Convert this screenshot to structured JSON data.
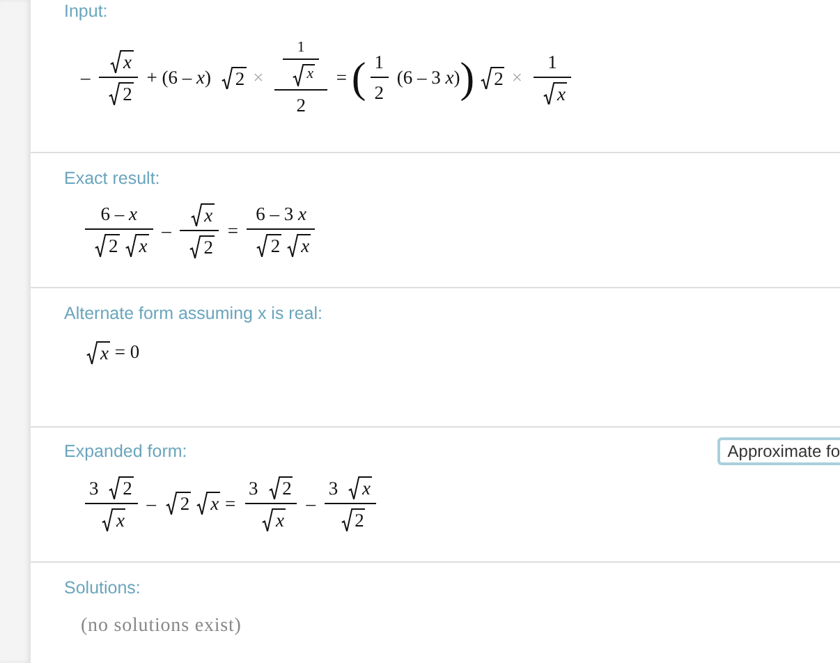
{
  "pods": [
    {
      "title": "Input:",
      "formula": [
        {
          "kind": "text",
          "text": "– "
        },
        {
          "kind": "frac",
          "num": [
            {
              "kind": "sqrt",
              "body": [
                {
                  "kind": "var",
                  "text": "x"
                }
              ]
            }
          ],
          "den": [
            {
              "kind": "sqrt",
              "body": [
                {
                  "kind": "text",
                  "text": "2"
                }
              ]
            }
          ]
        },
        {
          "kind": "text",
          "text": " + (6 – "
        },
        {
          "kind": "var",
          "text": "x"
        },
        {
          "kind": "text",
          "text": ") "
        },
        {
          "kind": "sqrt",
          "body": [
            {
              "kind": "text",
              "text": "2"
            }
          ]
        },
        {
          "kind": "times",
          "text": "×"
        },
        {
          "kind": "frac",
          "num": [
            {
              "kind": "frac",
              "num": [
                {
                  "kind": "text",
                  "text": "1"
                }
              ],
              "den": [
                {
                  "kind": "sqrt",
                  "body": [
                    {
                      "kind": "var",
                      "text": "x"
                    }
                  ]
                }
              ]
            }
          ],
          "den": [
            {
              "kind": "text",
              "text": "2"
            }
          ]
        },
        {
          "kind": "text",
          "text": " = "
        },
        {
          "kind": "paren",
          "open": "(",
          "close": ")",
          "body": [
            {
              "kind": "frac",
              "num": [
                {
                  "kind": "text",
                  "text": "1"
                }
              ],
              "den": [
                {
                  "kind": "text",
                  "text": "2"
                }
              ]
            },
            {
              "kind": "text",
              "text": " (6 – 3 "
            },
            {
              "kind": "var",
              "text": "x"
            },
            {
              "kind": "text",
              "text": ")"
            }
          ]
        },
        {
          "kind": "sqrt",
          "body": [
            {
              "kind": "text",
              "text": "2"
            }
          ]
        },
        {
          "kind": "times",
          "text": "×"
        },
        {
          "kind": "frac",
          "num": [
            {
              "kind": "text",
              "text": "1"
            }
          ],
          "den": [
            {
              "kind": "sqrt",
              "body": [
                {
                  "kind": "var",
                  "text": "x"
                }
              ]
            }
          ]
        }
      ]
    },
    {
      "title": "Exact result:",
      "formula": [
        {
          "kind": "frac",
          "num": [
            {
              "kind": "text",
              "text": "6 – "
            },
            {
              "kind": "var",
              "text": "x"
            }
          ],
          "den": [
            {
              "kind": "sqrt",
              "body": [
                {
                  "kind": "text",
                  "text": "2"
                }
              ]
            },
            {
              "kind": "sqrt",
              "body": [
                {
                  "kind": "var",
                  "text": "x"
                }
              ]
            }
          ]
        },
        {
          "kind": "text",
          "text": " – "
        },
        {
          "kind": "frac",
          "num": [
            {
              "kind": "sqrt",
              "body": [
                {
                  "kind": "var",
                  "text": "x"
                }
              ]
            }
          ],
          "den": [
            {
              "kind": "sqrt",
              "body": [
                {
                  "kind": "text",
                  "text": "2"
                }
              ]
            }
          ]
        },
        {
          "kind": "text",
          "text": " = "
        },
        {
          "kind": "frac",
          "num": [
            {
              "kind": "text",
              "text": "6 – 3 "
            },
            {
              "kind": "var",
              "text": "x"
            }
          ],
          "den": [
            {
              "kind": "sqrt",
              "body": [
                {
                  "kind": "text",
                  "text": "2"
                }
              ]
            },
            {
              "kind": "sqrt",
              "body": [
                {
                  "kind": "var",
                  "text": "x"
                }
              ]
            }
          ]
        }
      ]
    },
    {
      "title": "Alternate form assuming x is real:",
      "formula": [
        {
          "kind": "sqrt",
          "body": [
            {
              "kind": "var",
              "text": "x"
            }
          ]
        },
        {
          "kind": "text",
          "text": " = 0"
        }
      ]
    },
    {
      "title": "Expanded form:",
      "button": "Approximate fo",
      "formula": [
        {
          "kind": "frac",
          "num": [
            {
              "kind": "text",
              "text": "3 "
            },
            {
              "kind": "sqrt",
              "body": [
                {
                  "kind": "text",
                  "text": "2"
                }
              ]
            }
          ],
          "den": [
            {
              "kind": "sqrt",
              "body": [
                {
                  "kind": "var",
                  "text": "x"
                }
              ]
            }
          ]
        },
        {
          "kind": "text",
          "text": " – "
        },
        {
          "kind": "sqrt",
          "body": [
            {
              "kind": "text",
              "text": "2"
            }
          ]
        },
        {
          "kind": "sqrt",
          "body": [
            {
              "kind": "var",
              "text": "x"
            }
          ]
        },
        {
          "kind": "text",
          "text": " = "
        },
        {
          "kind": "frac",
          "num": [
            {
              "kind": "text",
              "text": "3 "
            },
            {
              "kind": "sqrt",
              "body": [
                {
                  "kind": "text",
                  "text": "2"
                }
              ]
            }
          ],
          "den": [
            {
              "kind": "sqrt",
              "body": [
                {
                  "kind": "var",
                  "text": "x"
                }
              ]
            }
          ]
        },
        {
          "kind": "text",
          "text": " – "
        },
        {
          "kind": "frac",
          "num": [
            {
              "kind": "text",
              "text": "3 "
            },
            {
              "kind": "sqrt",
              "body": [
                {
                  "kind": "var",
                  "text": "x"
                }
              ]
            }
          ],
          "den": [
            {
              "kind": "sqrt",
              "body": [
                {
                  "kind": "text",
                  "text": "2"
                }
              ]
            }
          ]
        }
      ]
    },
    {
      "title": "Solutions:",
      "result": "(no solutions exist)"
    }
  ]
}
